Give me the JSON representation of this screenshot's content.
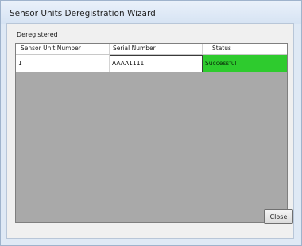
{
  "window": {
    "title": "Sensor Units Deregistration Wizard"
  },
  "group": {
    "label": "Deregistered"
  },
  "grid": {
    "columns": [
      "Sensor Unit Number",
      "Serial Number",
      "Status"
    ],
    "rows": [
      {
        "sensor_unit_number": "1",
        "serial_number": "AAAA1111",
        "status": "Successful",
        "status_color": "#2ecb2e"
      }
    ],
    "background_color": "#a9a9a9"
  },
  "buttons": {
    "close_label": "Close"
  }
}
